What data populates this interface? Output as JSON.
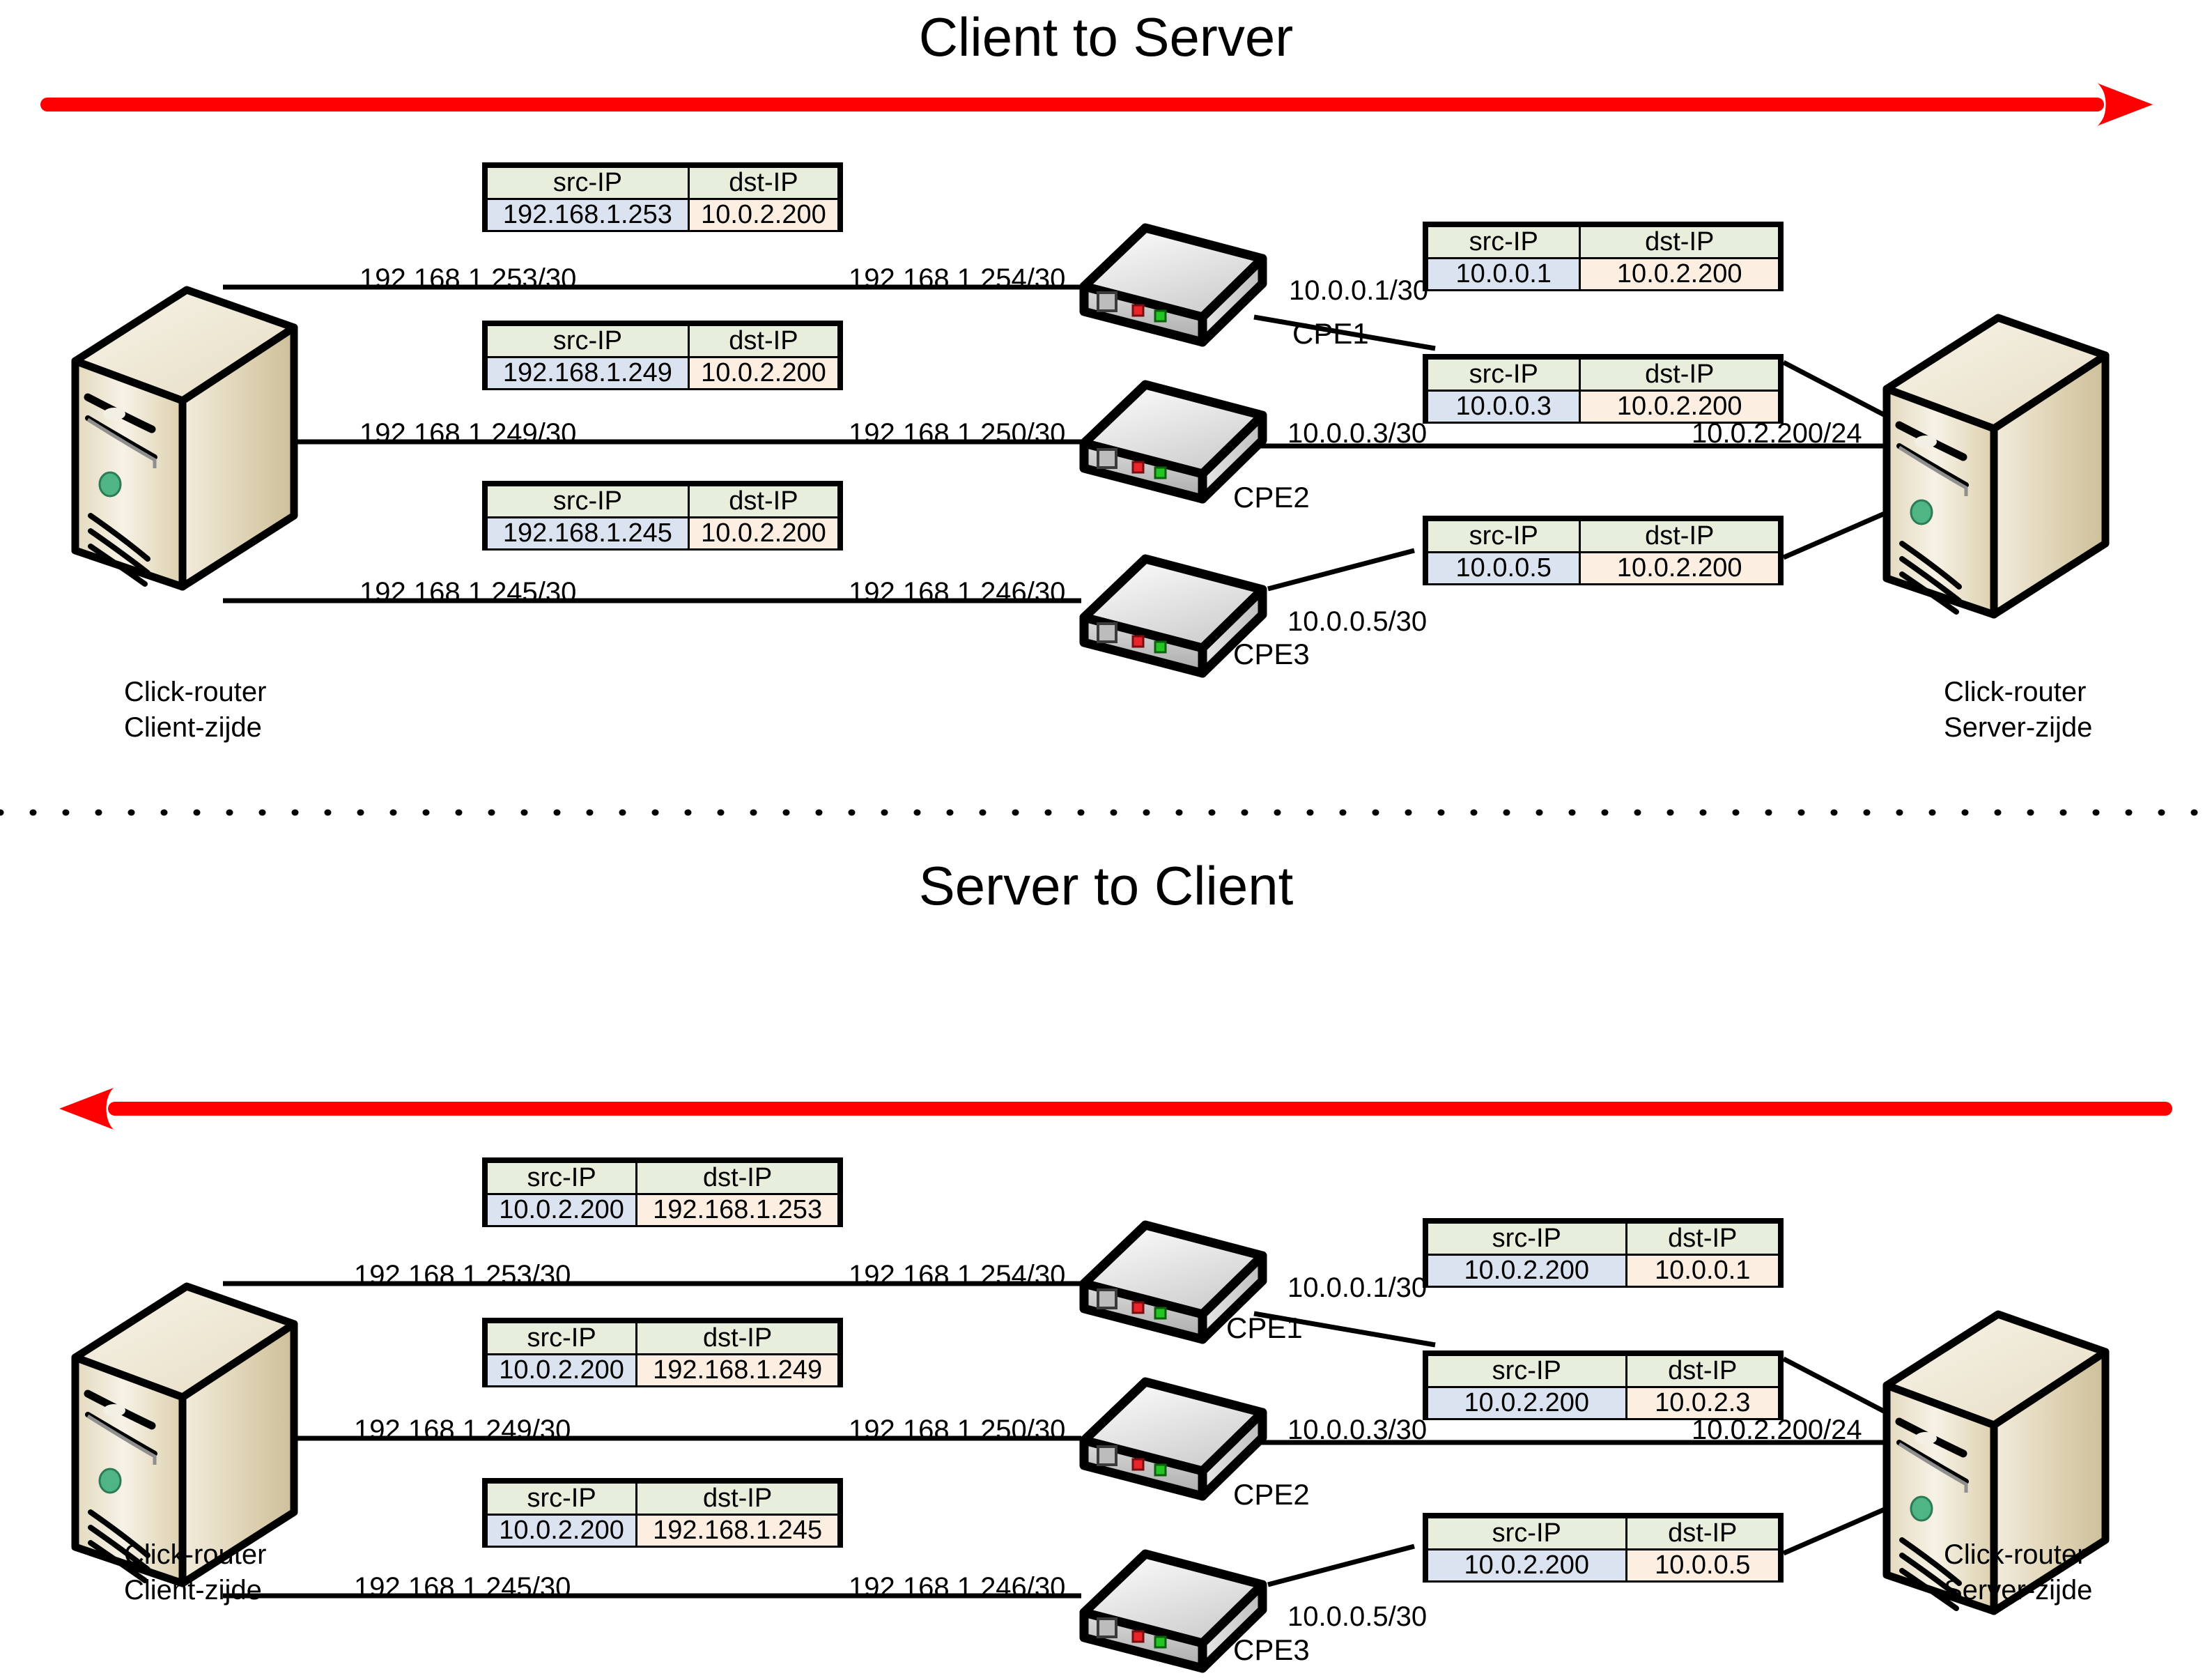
{
  "colors": {
    "arrow": "#ff0000",
    "table_header_bg": "#e8eedc",
    "src_cell_bg": "#dce3f0",
    "dst_cell_bg": "#fceee1",
    "server_body": "#d8cdae",
    "cpe_body": "#e9e9e9",
    "led_red": "#e8252a",
    "led_green": "#25c425",
    "server_led_green": "#4fb585",
    "line": "#000000"
  },
  "table_headers": {
    "src": "src-IP",
    "dst": "dst-IP"
  },
  "sections": [
    {
      "id": "client-to-server",
      "title": "Client to Server",
      "arrow_direction": "right",
      "left_node": {
        "line1": "Click-router",
        "line2": "Client-zijde"
      },
      "right_node": {
        "line1": "Click-router",
        "line2": "Server-zijde"
      },
      "right_link_label": "10.0.2.200/24",
      "rows": [
        {
          "cpe": "CPE1",
          "left_label": "192.168.1.253/30",
          "mid_label": "192.168.1.254/30",
          "right_label": "10.0.0.1/30",
          "left_packet": {
            "src": "192.168.1.253",
            "dst": "10.0.2.200"
          },
          "right_packet": {
            "src": "10.0.0.1",
            "dst": "10.0.2.200"
          }
        },
        {
          "cpe": "CPE2",
          "left_label": "192.168.1.249/30",
          "mid_label": "192.168.1.250/30",
          "right_label": "10.0.0.3/30",
          "left_packet": {
            "src": "192.168.1.249",
            "dst": "10.0.2.200"
          },
          "right_packet": {
            "src": "10.0.0.3",
            "dst": "10.0.2.200"
          }
        },
        {
          "cpe": "CPE3",
          "left_label": "192.168.1.245/30",
          "mid_label": "192.168.1.246/30",
          "right_label": "10.0.0.5/30",
          "left_packet": {
            "src": "192.168.1.245",
            "dst": "10.0.2.200"
          },
          "right_packet": {
            "src": "10.0.0.5",
            "dst": "10.0.2.200"
          }
        }
      ]
    },
    {
      "id": "server-to-client",
      "title": "Server to Client",
      "arrow_direction": "left",
      "left_node": {
        "line1": "Click-router",
        "line2": "Client-zijde"
      },
      "right_node": {
        "line1": "Click-router",
        "line2": "Server-zijde"
      },
      "right_link_label": "10.0.2.200/24",
      "rows": [
        {
          "cpe": "CPE1",
          "left_label": "192.168.1.253/30",
          "mid_label": "192.168.1.254/30",
          "right_label": "10.0.0.1/30",
          "left_packet": {
            "src": "10.0.2.200",
            "dst": "192.168.1.253"
          },
          "right_packet": {
            "src": "10.0.2.200",
            "dst": "10.0.0.1"
          }
        },
        {
          "cpe": "CPE2",
          "left_label": "192.168.1.249/30",
          "mid_label": "192.168.1.250/30",
          "right_label": "10.0.0.3/30",
          "left_packet": {
            "src": "10.0.2.200",
            "dst": "192.168.1.249"
          },
          "right_packet": {
            "src": "10.0.2.200",
            "dst": "10.0.2.3"
          }
        },
        {
          "cpe": "CPE3",
          "left_label": "192.168.1.245/30",
          "mid_label": "192.168.1.246/30",
          "right_label": "10.0.0.5/30",
          "left_packet": {
            "src": "10.0.2.200",
            "dst": "192.168.1.245"
          },
          "right_packet": {
            "src": "10.0.2.200",
            "dst": "10.0.0.5"
          }
        }
      ]
    }
  ]
}
